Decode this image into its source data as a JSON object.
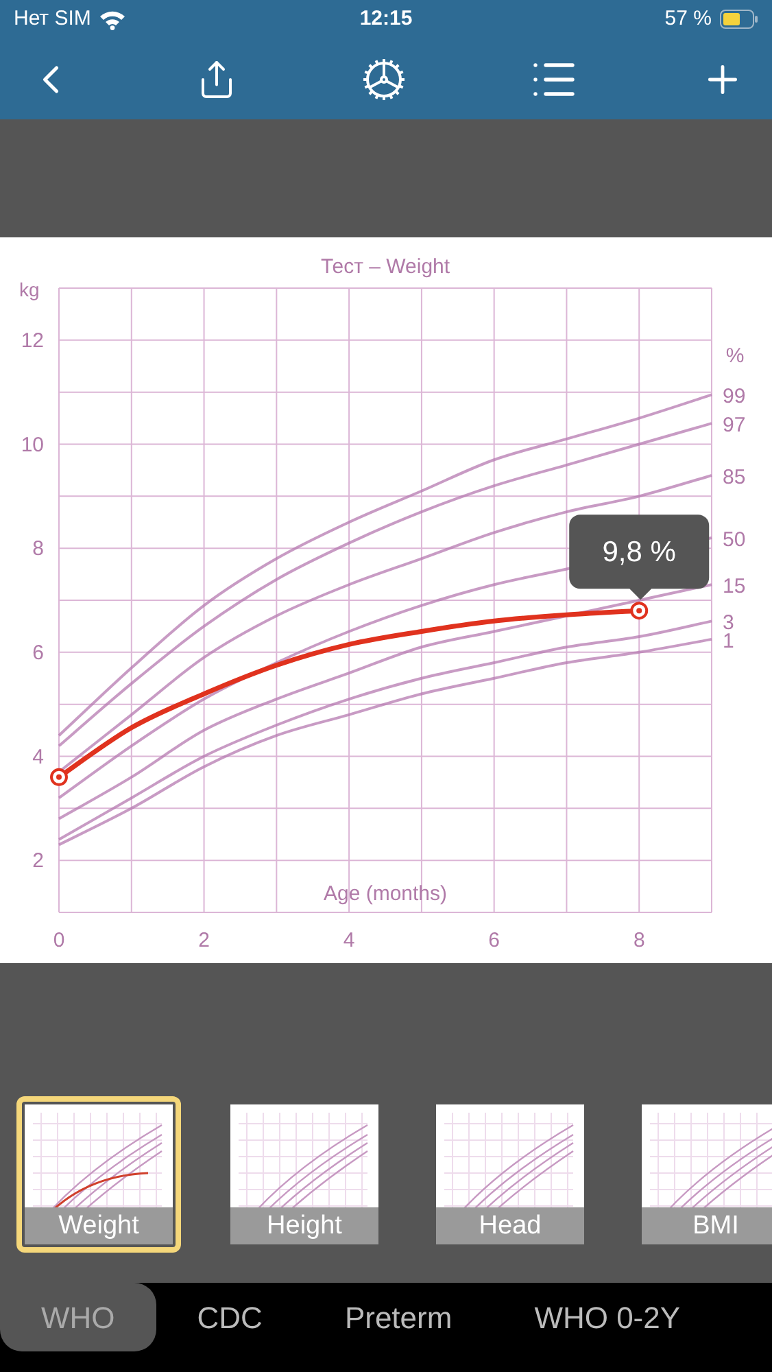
{
  "status_bar": {
    "carrier": "Нет SIM",
    "time": "12:15",
    "battery": "57 %"
  },
  "chart": {
    "unit_label": "%",
    "chart_data": {
      "type": "line",
      "title": "Тест – Weight",
      "xlabel": "Age (months)",
      "ylabel": "kg",
      "x": [
        0,
        1,
        2,
        3,
        4,
        5,
        6,
        7,
        8,
        9
      ],
      "xlim": [
        0,
        9
      ],
      "ylim": [
        1,
        13
      ],
      "xticks": [
        0,
        2,
        4,
        6,
        8
      ],
      "grid": true,
      "yticks": [
        2,
        4,
        6,
        8,
        10,
        12
      ],
      "series": [
        {
          "name": "99",
          "color": "#b67ab0",
          "values": [
            4.4,
            5.7,
            6.9,
            7.8,
            8.5,
            9.1,
            9.7,
            10.1,
            10.5,
            10.95
          ]
        },
        {
          "name": "97",
          "color": "#b67ab0",
          "values": [
            4.2,
            5.4,
            6.5,
            7.4,
            8.1,
            8.7,
            9.2,
            9.6,
            10.0,
            10.4
          ]
        },
        {
          "name": "85",
          "color": "#b67ab0",
          "values": [
            3.7,
            4.8,
            5.9,
            6.7,
            7.3,
            7.8,
            8.3,
            8.7,
            9.0,
            9.4
          ]
        },
        {
          "name": "50",
          "color": "#b67ab0",
          "values": [
            3.2,
            4.2,
            5.1,
            5.8,
            6.4,
            6.9,
            7.3,
            7.6,
            null,
            8.2
          ]
        },
        {
          "name": "15",
          "color": "#b67ab0",
          "values": [
            2.8,
            3.6,
            4.5,
            5.1,
            5.6,
            6.1,
            6.4,
            6.7,
            7.0,
            7.3
          ]
        },
        {
          "name": "3",
          "color": "#b67ab0",
          "values": [
            2.4,
            3.2,
            4.0,
            4.6,
            5.1,
            5.5,
            5.8,
            6.1,
            6.3,
            6.6
          ]
        },
        {
          "name": "1",
          "color": "#b67ab0",
          "values": [
            2.3,
            3.0,
            3.8,
            4.4,
            4.8,
            5.2,
            5.5,
            5.8,
            6.0,
            6.25
          ]
        },
        {
          "color": "#e0321e",
          "values": [
            3.6,
            4.55,
            5.2,
            5.75,
            6.15,
            6.4,
            6.6,
            6.72,
            6.8,
            null
          ]
        }
      ],
      "annotations": [
        {
          "text": "9,8 %",
          "x": 8,
          "y": 6.8
        }
      ]
    }
  },
  "thumbnails": [
    {
      "label": "Weight",
      "selected": true
    },
    {
      "label": "Height",
      "selected": false
    },
    {
      "label": "Head",
      "selected": false
    },
    {
      "label": "BMI",
      "selected": false
    }
  ],
  "tabs": [
    {
      "label": "WHO",
      "selected": true
    },
    {
      "label": "CDC",
      "selected": false
    },
    {
      "label": "Preterm",
      "selected": false
    },
    {
      "label": "WHO 0-2Y",
      "selected": false
    }
  ]
}
